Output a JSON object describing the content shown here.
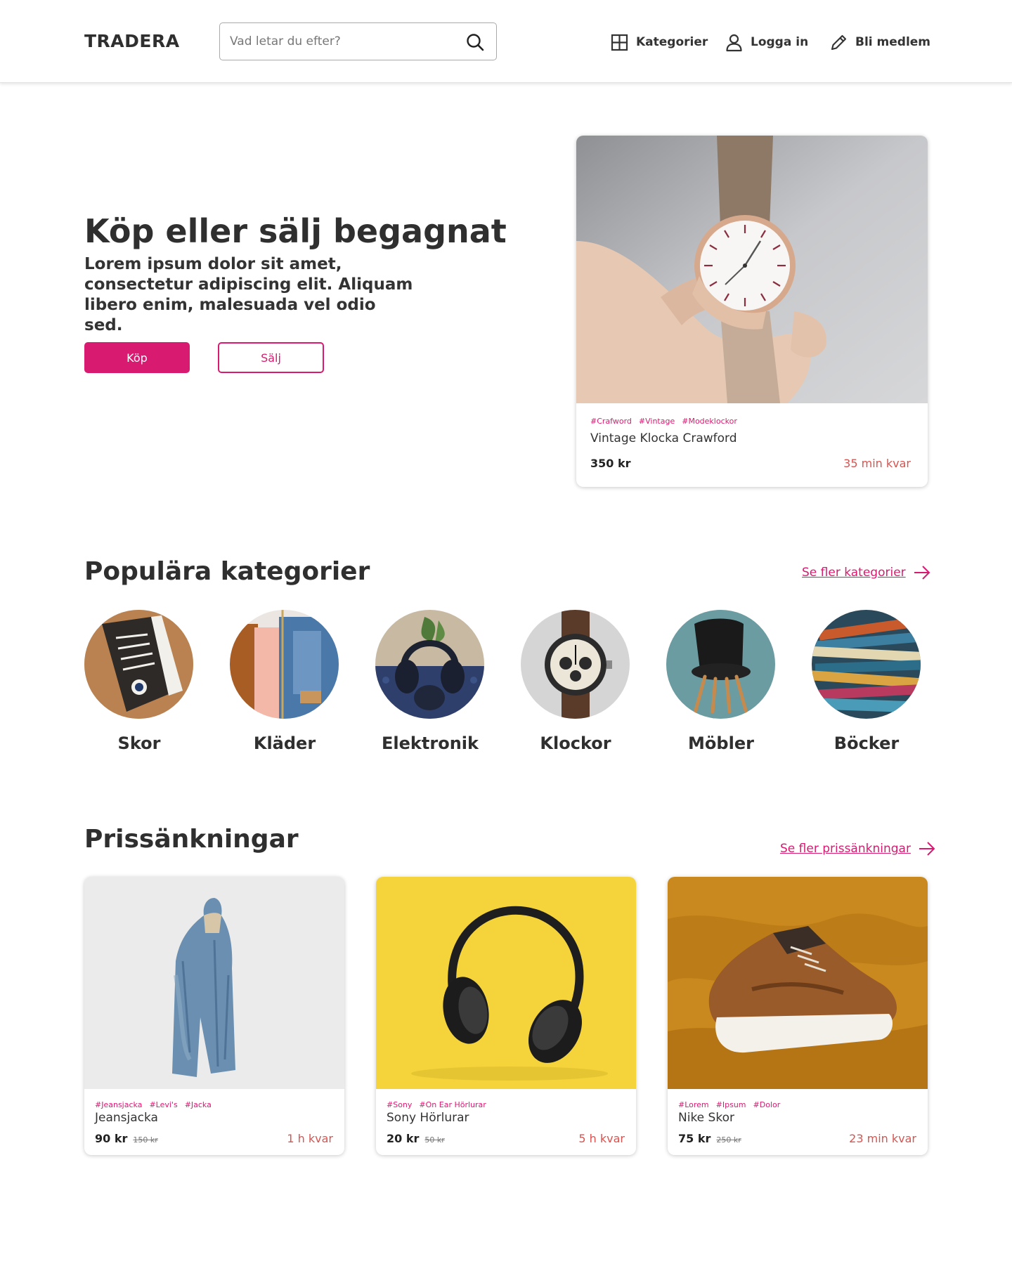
{
  "header": {
    "logo": "TRADERA",
    "search_placeholder": "Vad letar du efter?",
    "nav": {
      "categories": "Kategorier",
      "login": "Logga in",
      "register": "Bli medlem"
    }
  },
  "hero": {
    "title": "Köp eller sälj begagnat",
    "subtitle": "Lorem ipsum dolor sit amet, consectetur adipiscing elit. Aliquam libero enim, malesuada vel odio sed.",
    "buy_label": "Köp",
    "sell_label": "Sälj"
  },
  "featured": {
    "tags": [
      "#Crafword",
      "#Vintage",
      "#Modeklockor"
    ],
    "title": "Vintage Klocka Crawford",
    "price": "350 kr",
    "time_left": "35 min kvar"
  },
  "categories": {
    "title": "Populära kategorier",
    "see_more": "Se fler kategorier",
    "items": [
      {
        "label": "Skor",
        "icon": "shoe-photo"
      },
      {
        "label": "Kläder",
        "icon": "clothes-photo"
      },
      {
        "label": "Elektronik",
        "icon": "headphones-photo"
      },
      {
        "label": "Klockor",
        "icon": "watch-photo"
      },
      {
        "label": "Möbler",
        "icon": "chair-photo"
      },
      {
        "label": "Böcker",
        "icon": "books-photo"
      }
    ]
  },
  "deals": {
    "title": "Prissänkningar",
    "see_more": "Se fler prissänkningar",
    "items": [
      {
        "tags": [
          "#Jeansjacka",
          "#Levi's",
          "#Jacka"
        ],
        "title": "Jeansjacka",
        "price": "90 kr",
        "old_price": "150 kr",
        "time_left": "1 h kvar"
      },
      {
        "tags": [
          "#Sony",
          "#On Ear Hörlurar"
        ],
        "title": "Sony Hörlurar",
        "price": "20 kr",
        "old_price": "50 kr",
        "time_left": "5 h kvar"
      },
      {
        "tags": [
          "#Lorem",
          "#Ipsum",
          "#Dolor"
        ],
        "title": "Nike Skor",
        "price": "75 kr",
        "old_price": "250 kr",
        "time_left": "23 min kvar"
      }
    ]
  },
  "colors": {
    "accent": "#d81b70",
    "time_left": "#d9534f",
    "text": "#2f2f2f"
  }
}
